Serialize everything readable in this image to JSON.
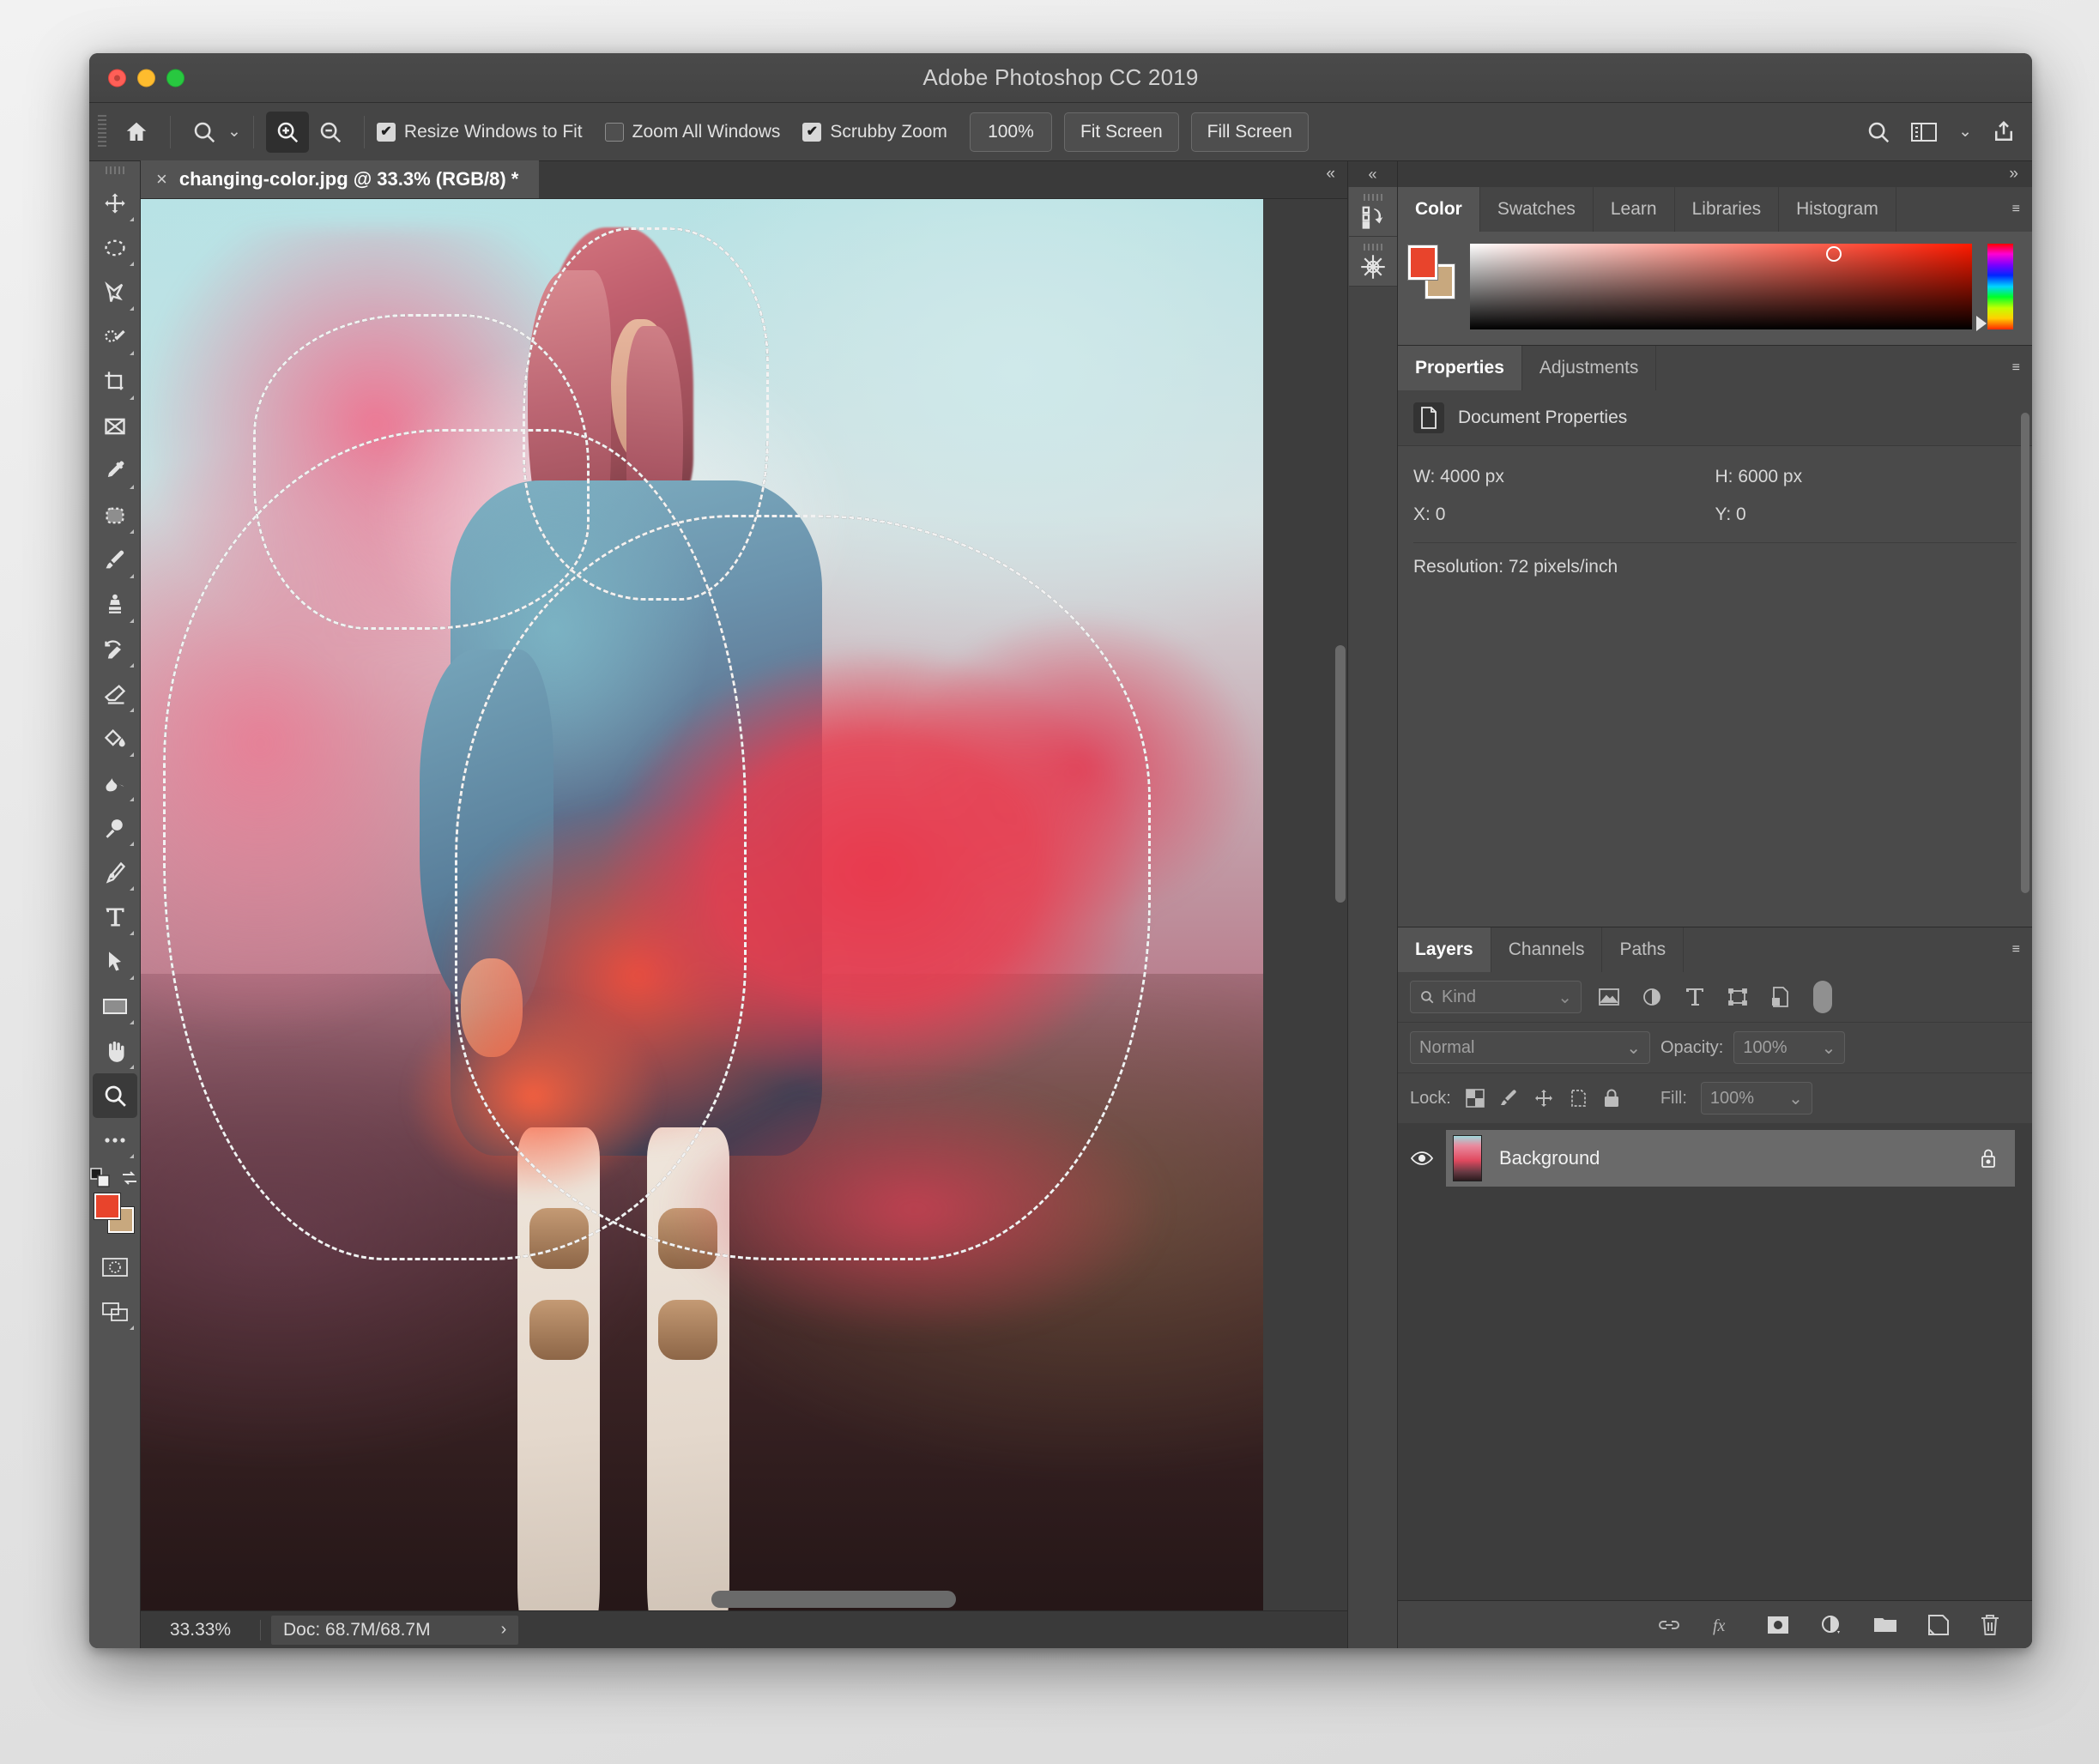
{
  "window": {
    "title": "Adobe Photoshop CC 2019",
    "traffic": {
      "close": "close-button",
      "minimize": "minimize-button",
      "maximize": "maximize-button"
    }
  },
  "options_bar": {
    "home_label": "Home",
    "tool_preset_label": "Zoom Tool",
    "zoom_in_label": "Zoom In",
    "zoom_out_label": "Zoom Out",
    "checkboxes": [
      {
        "label": "Resize Windows to Fit",
        "checked": true
      },
      {
        "label": "Zoom All Windows",
        "checked": false
      },
      {
        "label": "Scrubby Zoom",
        "checked": true
      }
    ],
    "buttons": [
      {
        "label": "100%"
      },
      {
        "label": "Fit Screen"
      },
      {
        "label": "Fill Screen"
      }
    ],
    "right_icons": [
      "search-icon",
      "workspace-icon",
      "chevron-down-icon",
      "share-icon"
    ]
  },
  "document": {
    "tab_label": "changing-color.jpg @ 33.3% (RGB/8) *",
    "close_glyph": "×",
    "collapse_glyph": "«"
  },
  "tools": [
    {
      "name": "move-tool",
      "selected": false,
      "more": true
    },
    {
      "name": "elliptical-marquee-tool",
      "selected": false,
      "more": true
    },
    {
      "name": "lasso-tool",
      "selected": false,
      "more": true
    },
    {
      "name": "quick-selection-tool",
      "selected": false,
      "more": true
    },
    {
      "name": "crop-tool",
      "selected": false,
      "more": true
    },
    {
      "name": "frame-tool",
      "selected": false,
      "more": false
    },
    {
      "name": "eyedropper-tool",
      "selected": false,
      "more": true
    },
    {
      "name": "spot-healing-brush-tool",
      "selected": false,
      "more": true
    },
    {
      "name": "brush-tool",
      "selected": false,
      "more": true
    },
    {
      "name": "clone-stamp-tool",
      "selected": false,
      "more": true
    },
    {
      "name": "history-brush-tool",
      "selected": false,
      "more": true
    },
    {
      "name": "eraser-tool",
      "selected": false,
      "more": true
    },
    {
      "name": "gradient-tool",
      "selected": false,
      "more": true
    },
    {
      "name": "blur-tool",
      "selected": false,
      "more": true
    },
    {
      "name": "dodge-tool",
      "selected": false,
      "more": true
    },
    {
      "name": "pen-tool",
      "selected": false,
      "more": true
    },
    {
      "name": "type-tool",
      "selected": false,
      "more": true
    },
    {
      "name": "path-selection-tool",
      "selected": false,
      "more": true
    },
    {
      "name": "rectangle-tool",
      "selected": false,
      "more": true
    },
    {
      "name": "hand-tool",
      "selected": false,
      "more": true
    },
    {
      "name": "zoom-tool",
      "selected": true,
      "more": false
    },
    {
      "name": "edit-toolbar-tool",
      "selected": false,
      "more": true
    }
  ],
  "colors": {
    "foreground": "#e8442c",
    "background": "#c8a87e",
    "accent_red": "#ea3a4a"
  },
  "rail": {
    "collapse_glyph": "«",
    "buttons": [
      "history-panel-icon",
      "actions-panel-icon"
    ]
  },
  "panels": {
    "expand_glyph": "»",
    "menu_glyph": "≡",
    "color_group": {
      "tabs": [
        "Color",
        "Swatches",
        "Learn",
        "Libraries",
        "Histogram"
      ],
      "active_tab": "Color"
    },
    "properties_group": {
      "tabs": [
        "Properties",
        "Adjustments"
      ],
      "active_tab": "Properties",
      "header_label": "Document Properties",
      "fields": [
        {
          "label": "W:",
          "value": "4000 px"
        },
        {
          "label": "H:",
          "value": "6000 px"
        },
        {
          "label": "X:",
          "value": "0"
        },
        {
          "label": "Y:",
          "value": "0"
        }
      ],
      "resolution": "Resolution: 72 pixels/inch"
    },
    "layers_group": {
      "tabs": [
        "Layers",
        "Channels",
        "Paths"
      ],
      "active_tab": "Layers",
      "filter_placeholder": "Kind",
      "filter_icons": [
        "pixel-layer-filter-icon",
        "adjustment-layer-filter-icon",
        "type-layer-filter-icon",
        "shape-layer-filter-icon",
        "smart-object-filter-icon"
      ],
      "blend_mode": "Normal",
      "opacity_label": "Opacity:",
      "opacity_value": "100%",
      "lock_label": "Lock:",
      "lock_icons": [
        "lock-transparent-pixels-icon",
        "lock-image-pixels-icon",
        "lock-position-icon",
        "lock-artboard-icon",
        "lock-all-icon"
      ],
      "fill_label": "Fill:",
      "fill_value": "100%",
      "layers": [
        {
          "name": "Background",
          "visible": true,
          "locked": true,
          "selected": true
        }
      ],
      "footer_icons": [
        "link-layers-icon",
        "layer-style-fx-icon",
        "add-layer-mask-icon",
        "new-adjustment-layer-icon",
        "new-group-icon",
        "new-layer-icon",
        "delete-layer-icon"
      ]
    }
  },
  "status_bar": {
    "zoom": "33.33%",
    "doc_info": "Doc: 68.7M/68.7M",
    "arrow_glyph": "›"
  }
}
